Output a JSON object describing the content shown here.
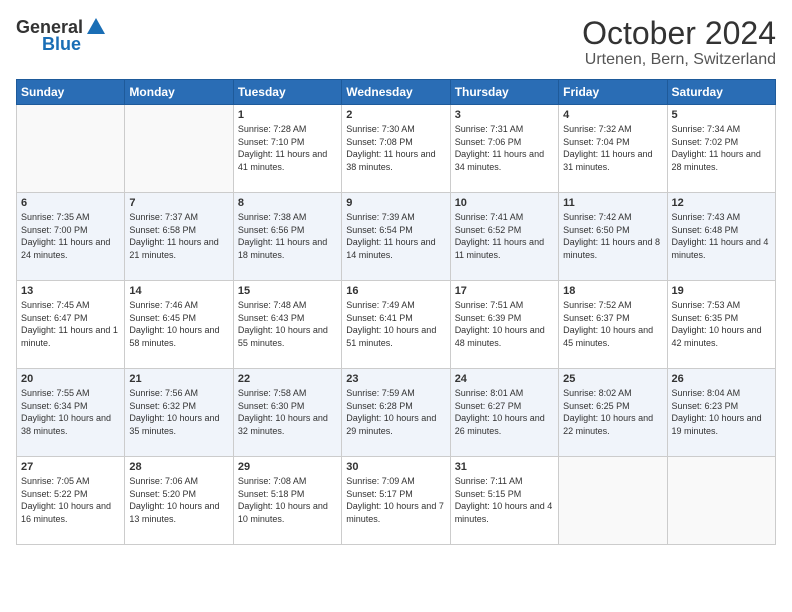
{
  "header": {
    "logo_general": "General",
    "logo_blue": "Blue",
    "month": "October 2024",
    "location": "Urtenen, Bern, Switzerland"
  },
  "days_of_week": [
    "Sunday",
    "Monday",
    "Tuesday",
    "Wednesday",
    "Thursday",
    "Friday",
    "Saturday"
  ],
  "weeks": [
    [
      {
        "day": "",
        "sunrise": "",
        "sunset": "",
        "daylight": ""
      },
      {
        "day": "",
        "sunrise": "",
        "sunset": "",
        "daylight": ""
      },
      {
        "day": "1",
        "sunrise": "Sunrise: 7:28 AM",
        "sunset": "Sunset: 7:10 PM",
        "daylight": "Daylight: 11 hours and 41 minutes."
      },
      {
        "day": "2",
        "sunrise": "Sunrise: 7:30 AM",
        "sunset": "Sunset: 7:08 PM",
        "daylight": "Daylight: 11 hours and 38 minutes."
      },
      {
        "day": "3",
        "sunrise": "Sunrise: 7:31 AM",
        "sunset": "Sunset: 7:06 PM",
        "daylight": "Daylight: 11 hours and 34 minutes."
      },
      {
        "day": "4",
        "sunrise": "Sunrise: 7:32 AM",
        "sunset": "Sunset: 7:04 PM",
        "daylight": "Daylight: 11 hours and 31 minutes."
      },
      {
        "day": "5",
        "sunrise": "Sunrise: 7:34 AM",
        "sunset": "Sunset: 7:02 PM",
        "daylight": "Daylight: 11 hours and 28 minutes."
      }
    ],
    [
      {
        "day": "6",
        "sunrise": "Sunrise: 7:35 AM",
        "sunset": "Sunset: 7:00 PM",
        "daylight": "Daylight: 11 hours and 24 minutes."
      },
      {
        "day": "7",
        "sunrise": "Sunrise: 7:37 AM",
        "sunset": "Sunset: 6:58 PM",
        "daylight": "Daylight: 11 hours and 21 minutes."
      },
      {
        "day": "8",
        "sunrise": "Sunrise: 7:38 AM",
        "sunset": "Sunset: 6:56 PM",
        "daylight": "Daylight: 11 hours and 18 minutes."
      },
      {
        "day": "9",
        "sunrise": "Sunrise: 7:39 AM",
        "sunset": "Sunset: 6:54 PM",
        "daylight": "Daylight: 11 hours and 14 minutes."
      },
      {
        "day": "10",
        "sunrise": "Sunrise: 7:41 AM",
        "sunset": "Sunset: 6:52 PM",
        "daylight": "Daylight: 11 hours and 11 minutes."
      },
      {
        "day": "11",
        "sunrise": "Sunrise: 7:42 AM",
        "sunset": "Sunset: 6:50 PM",
        "daylight": "Daylight: 11 hours and 8 minutes."
      },
      {
        "day": "12",
        "sunrise": "Sunrise: 7:43 AM",
        "sunset": "Sunset: 6:48 PM",
        "daylight": "Daylight: 11 hours and 4 minutes."
      }
    ],
    [
      {
        "day": "13",
        "sunrise": "Sunrise: 7:45 AM",
        "sunset": "Sunset: 6:47 PM",
        "daylight": "Daylight: 11 hours and 1 minute."
      },
      {
        "day": "14",
        "sunrise": "Sunrise: 7:46 AM",
        "sunset": "Sunset: 6:45 PM",
        "daylight": "Daylight: 10 hours and 58 minutes."
      },
      {
        "day": "15",
        "sunrise": "Sunrise: 7:48 AM",
        "sunset": "Sunset: 6:43 PM",
        "daylight": "Daylight: 10 hours and 55 minutes."
      },
      {
        "day": "16",
        "sunrise": "Sunrise: 7:49 AM",
        "sunset": "Sunset: 6:41 PM",
        "daylight": "Daylight: 10 hours and 51 minutes."
      },
      {
        "day": "17",
        "sunrise": "Sunrise: 7:51 AM",
        "sunset": "Sunset: 6:39 PM",
        "daylight": "Daylight: 10 hours and 48 minutes."
      },
      {
        "day": "18",
        "sunrise": "Sunrise: 7:52 AM",
        "sunset": "Sunset: 6:37 PM",
        "daylight": "Daylight: 10 hours and 45 minutes."
      },
      {
        "day": "19",
        "sunrise": "Sunrise: 7:53 AM",
        "sunset": "Sunset: 6:35 PM",
        "daylight": "Daylight: 10 hours and 42 minutes."
      }
    ],
    [
      {
        "day": "20",
        "sunrise": "Sunrise: 7:55 AM",
        "sunset": "Sunset: 6:34 PM",
        "daylight": "Daylight: 10 hours and 38 minutes."
      },
      {
        "day": "21",
        "sunrise": "Sunrise: 7:56 AM",
        "sunset": "Sunset: 6:32 PM",
        "daylight": "Daylight: 10 hours and 35 minutes."
      },
      {
        "day": "22",
        "sunrise": "Sunrise: 7:58 AM",
        "sunset": "Sunset: 6:30 PM",
        "daylight": "Daylight: 10 hours and 32 minutes."
      },
      {
        "day": "23",
        "sunrise": "Sunrise: 7:59 AM",
        "sunset": "Sunset: 6:28 PM",
        "daylight": "Daylight: 10 hours and 29 minutes."
      },
      {
        "day": "24",
        "sunrise": "Sunrise: 8:01 AM",
        "sunset": "Sunset: 6:27 PM",
        "daylight": "Daylight: 10 hours and 26 minutes."
      },
      {
        "day": "25",
        "sunrise": "Sunrise: 8:02 AM",
        "sunset": "Sunset: 6:25 PM",
        "daylight": "Daylight: 10 hours and 22 minutes."
      },
      {
        "day": "26",
        "sunrise": "Sunrise: 8:04 AM",
        "sunset": "Sunset: 6:23 PM",
        "daylight": "Daylight: 10 hours and 19 minutes."
      }
    ],
    [
      {
        "day": "27",
        "sunrise": "Sunrise: 7:05 AM",
        "sunset": "Sunset: 5:22 PM",
        "daylight": "Daylight: 10 hours and 16 minutes."
      },
      {
        "day": "28",
        "sunrise": "Sunrise: 7:06 AM",
        "sunset": "Sunset: 5:20 PM",
        "daylight": "Daylight: 10 hours and 13 minutes."
      },
      {
        "day": "29",
        "sunrise": "Sunrise: 7:08 AM",
        "sunset": "Sunset: 5:18 PM",
        "daylight": "Daylight: 10 hours and 10 minutes."
      },
      {
        "day": "30",
        "sunrise": "Sunrise: 7:09 AM",
        "sunset": "Sunset: 5:17 PM",
        "daylight": "Daylight: 10 hours and 7 minutes."
      },
      {
        "day": "31",
        "sunrise": "Sunrise: 7:11 AM",
        "sunset": "Sunset: 5:15 PM",
        "daylight": "Daylight: 10 hours and 4 minutes."
      },
      {
        "day": "",
        "sunrise": "",
        "sunset": "",
        "daylight": ""
      },
      {
        "day": "",
        "sunrise": "",
        "sunset": "",
        "daylight": ""
      }
    ]
  ]
}
